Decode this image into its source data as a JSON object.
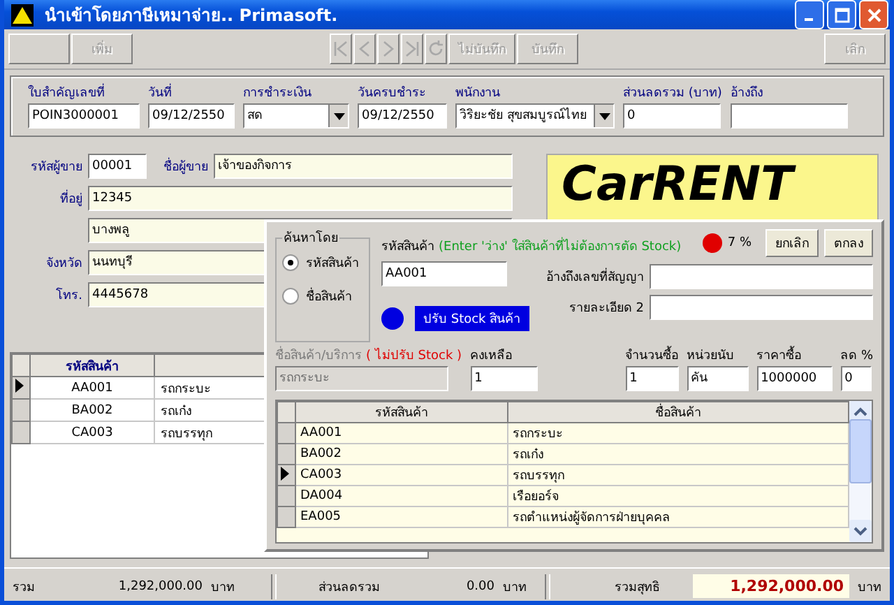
{
  "window": {
    "title": "นำเข้าโดยภาษีเหมาจ่าย.. Primasoft."
  },
  "toolbar": [
    {
      "kind": "blank"
    },
    {
      "kind": "text",
      "label": "เพิ่ม",
      "disabled": true
    },
    {
      "kind": "first",
      "disabled": true
    },
    {
      "kind": "prev",
      "disabled": true
    },
    {
      "kind": "next",
      "disabled": true
    },
    {
      "kind": "last",
      "disabled": true
    },
    {
      "kind": "refresh",
      "disabled": true
    },
    {
      "kind": "text",
      "label": "ไม่บันทึก",
      "disabled": true
    },
    {
      "kind": "text",
      "label": "บันทึก",
      "disabled": true
    },
    {
      "kind": "spacer"
    },
    {
      "kind": "text",
      "label": "เลิก",
      "disabled": true
    }
  ],
  "header": [
    {
      "label": "ใบสำคัญเลขที่",
      "value": "POIN3000001",
      "kind": "text"
    },
    {
      "label": "วันที่",
      "value": "09/12/2550",
      "kind": "text"
    },
    {
      "label": "การชำระเงิน",
      "value": "สด",
      "kind": "dropdown"
    },
    {
      "label": "วันครบชำระ",
      "value": "09/12/2550",
      "kind": "text"
    },
    {
      "label": "พนักงาน",
      "value": "วิริยะชัย  สุขสมบูรณ์ไทย",
      "kind": "dropdown"
    },
    {
      "label": "ส่วนลดรวม (บาท)",
      "value": "0",
      "kind": "text"
    },
    {
      "label": "อ้างถึง",
      "kind": "text"
    }
  ],
  "seller": {
    "code_label": "รหัสผู้ขาย",
    "code": "00001",
    "name_label": "ชื่อผู้ขาย",
    "name": "เจ้าของกิจการ",
    "address_label": "ที่อยู่",
    "address": [
      "12345",
      "บางพลู"
    ],
    "province_label": "จังหวัด",
    "province": "นนทบุรี",
    "phone_label": "โทร.",
    "phone": "4445678"
  },
  "logo": {
    "text": "CarRENT"
  },
  "items_grid": {
    "column_1": "รหัสสินค้า",
    "rows": [
      {
        "code": "AA001",
        "name": "รถกระบะ",
        "selected": true
      },
      {
        "code": "BA002",
        "name": "รถเก๋ง",
        "selected": false
      },
      {
        "code": "CA003",
        "name": "รถบรรทุก",
        "selected": false
      }
    ]
  },
  "footer": {
    "total_label": "รวม",
    "total": "1,292,000.00",
    "total_unit": "บาท",
    "discount_label": "ส่วนลดรวม",
    "discount": "0.00",
    "discount_unit": "บาท",
    "net_label": "รวมสุทธิ",
    "net": "1,292,000.00",
    "net_unit": "บาท"
  },
  "dialog": {
    "search_group": "ค้นหาโดย",
    "search_options": [
      {
        "label": "รหัสสินค้า",
        "selected": true
      },
      {
        "label": "ชื่อสินค้า",
        "selected": false
      }
    ],
    "code_label": "รหัสสินค้า",
    "code_hint": "(Enter 'ว่าง' ใส่สินค้าที่ไม่ต้องการตัด Stock)",
    "code": "AA001",
    "stock_indicator": {
      "color": "#0000e0",
      "label": "ปรับ Stock สินค้า"
    },
    "progress_indicator": {
      "color": "#e00000",
      "text": "7 %"
    },
    "buttons": [
      "ยกเลิก",
      "ตกลง"
    ],
    "contract_label": "อ้างถึงเลขที่สัญญา",
    "detail_label": "รายละเอียด 2",
    "product_name_label": "ชื่อสินค้า/บริการ",
    "product_name_note": "( ไม่ปรับ Stock )",
    "product_name": "รถกระบะ",
    "product_name_disabled": true,
    "remaining_label": "คงเหลือ",
    "remaining": "1",
    "qty_label": "จำนวนซื้อ",
    "qty": "1",
    "unit_label": "หน่วยนับ",
    "unit": "คัน",
    "price_label": "ราคาซื้อ",
    "price": "1000000",
    "discount_label": "ลด %",
    "discount": "0",
    "grid": {
      "columns": [
        "รหัสสินค้า",
        "ชื่อสินค้า"
      ],
      "rows": [
        {
          "code": "AA001",
          "name": "รถกระบะ",
          "selected": false
        },
        {
          "code": "BA002",
          "name": "รถเก๋ง",
          "selected": false
        },
        {
          "code": "CA003",
          "name": "รถบรรทุก",
          "selected": true
        },
        {
          "code": "DA004",
          "name": "เรือยอร์จ",
          "selected": false
        },
        {
          "code": "EA005",
          "name": "รถตำแหน่งผู้จัดการฝ่ายบุคคล",
          "selected": false
        }
      ]
    }
  }
}
